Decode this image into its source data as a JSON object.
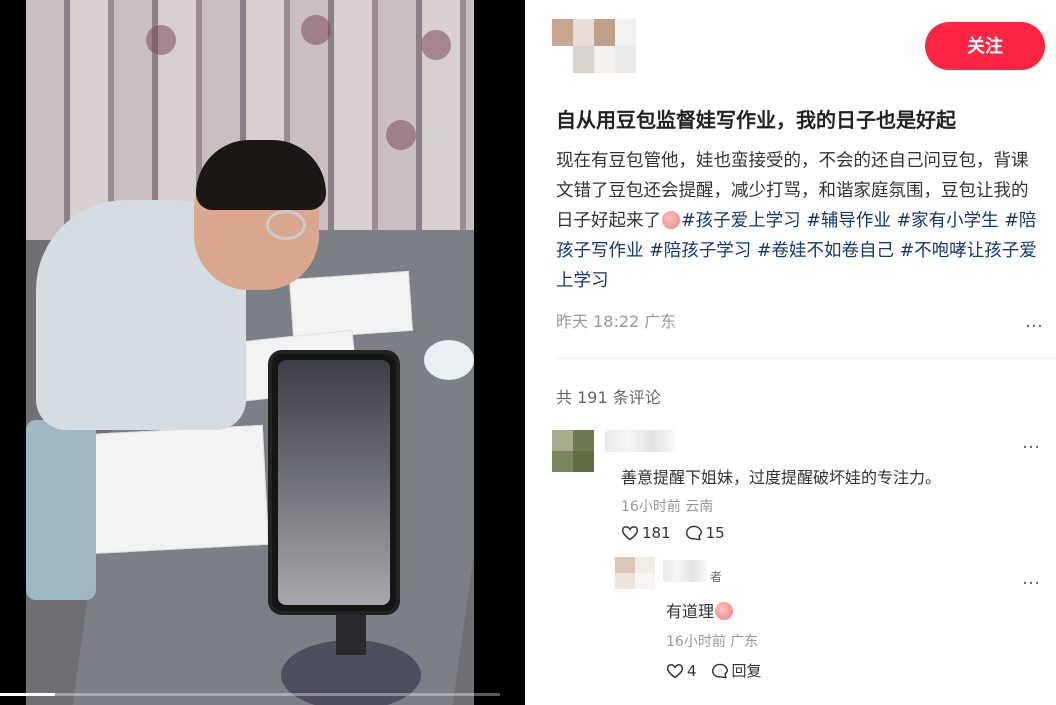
{
  "post": {
    "follow_label": "关注",
    "title": "自从用豆包监督娃写作业，我的日子也是好起",
    "body_prefix": "现在有豆包管他，娃也蛮接受的，不会的还自己问豆包，背课文错了豆包还会提醒，减少打骂，和谐家庭氛围，豆包让我的日子好起来了",
    "tags": [
      "#孩子爱上学习",
      "#辅导作业",
      "#家有小学生",
      "#陪孩子写作业",
      "#陪孩子学习",
      "#卷娃不如卷自己",
      "#不咆哮让孩子爱上学习"
    ],
    "date_location": "昨天 18:22 广东",
    "more_icon": "…",
    "comment_count_label": "共 191 条评论"
  },
  "video": {
    "progress_fraction": 0.11
  },
  "comments": [
    {
      "text": "善意提醒下姐妹，过度提醒破坏娃的专注力。",
      "meta": "16小时前 云南",
      "likes": "181",
      "replies": "15",
      "more_icon": "…"
    },
    {
      "author_tag": "者",
      "text_prefix": "有道理",
      "meta": "16小时前 广东",
      "likes": "4",
      "reply_label": "回复",
      "more_icon": "…"
    }
  ],
  "colors": {
    "accent": "#ff2442",
    "tag": "#13386c",
    "muted": "#999999"
  },
  "icons": [
    "heart-icon",
    "comment-bubble-icon",
    "peach-emoji-icon",
    "more-options-icon"
  ]
}
